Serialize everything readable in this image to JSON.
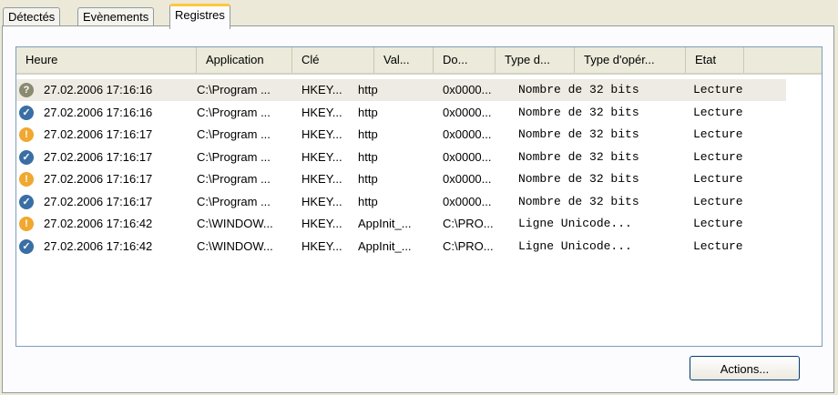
{
  "tabs": [
    "Détectés",
    "Evènements",
    "Registres"
  ],
  "active_tab": "Registres",
  "columns": [
    "Heure",
    "Application",
    "Clé",
    "Val...",
    "Do...",
    "Type d...",
    "Type d'opér...",
    "Etat"
  ],
  "rows": [
    {
      "icon": "unknown",
      "time": "27.02.2006 17:16:16",
      "app": "C:\\Program ...",
      "key": "HKEY...",
      "value": "http",
      "data": "0x0000...",
      "type": "Nombre de 32 bits",
      "state": "Lecture"
    },
    {
      "icon": "allowed",
      "time": "27.02.2006 17:16:16",
      "app": "C:\\Program ...",
      "key": "HKEY...",
      "value": "http",
      "data": "0x0000...",
      "type": "Nombre de 32 bits",
      "state": "Lecture"
    },
    {
      "icon": "warning",
      "time": "27.02.2006 17:16:17",
      "app": "C:\\Program ...",
      "key": "HKEY...",
      "value": "http",
      "data": "0x0000...",
      "type": "Nombre de 32 bits",
      "state": "Lecture"
    },
    {
      "icon": "allowed",
      "time": "27.02.2006 17:16:17",
      "app": "C:\\Program ...",
      "key": "HKEY...",
      "value": "http",
      "data": "0x0000...",
      "type": "Nombre de 32 bits",
      "state": "Lecture"
    },
    {
      "icon": "warning",
      "time": "27.02.2006 17:16:17",
      "app": "C:\\Program ...",
      "key": "HKEY...",
      "value": "http",
      "data": "0x0000...",
      "type": "Nombre de 32 bits",
      "state": "Lecture"
    },
    {
      "icon": "allowed",
      "time": "27.02.2006 17:16:17",
      "app": "C:\\Program ...",
      "key": "HKEY...",
      "value": "http",
      "data": "0x0000...",
      "type": "Nombre de 32 bits",
      "state": "Lecture"
    },
    {
      "icon": "warning",
      "time": "27.02.2006 17:16:42",
      "app": "C:\\WINDOW...",
      "key": "HKEY...",
      "value": "AppInit_...",
      "data": "C:\\PRO...",
      "type": "Ligne Unicode...",
      "state": "Lecture"
    },
    {
      "icon": "allowed",
      "time": "27.02.2006 17:16:42",
      "app": "C:\\WINDOW...",
      "key": "HKEY...",
      "value": "AppInit_...",
      "data": "C:\\PRO...",
      "type": "Ligne Unicode...",
      "state": "Lecture"
    }
  ],
  "actions_label": "Actions...",
  "colors": {
    "allowed": "#3a6ea5",
    "warning": "#f0a830",
    "unknown": "#8a8a70"
  }
}
